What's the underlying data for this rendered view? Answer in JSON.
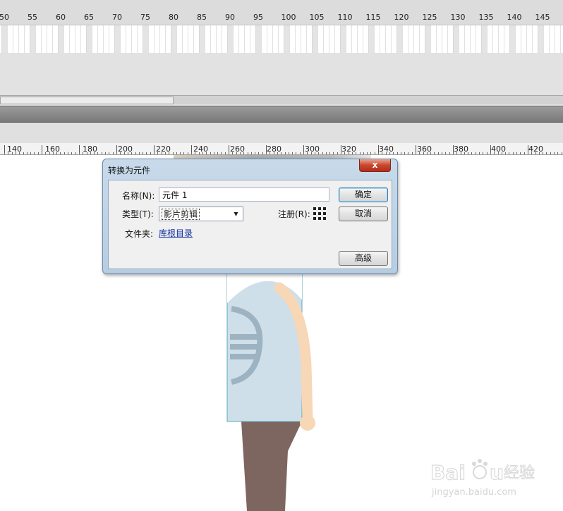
{
  "timeline": {
    "frame_numbers": [
      "50",
      "55",
      "60",
      "65",
      "70",
      "75",
      "80",
      "85",
      "90",
      "95",
      "100",
      "105",
      "110",
      "115",
      "120",
      "125",
      "130",
      "135",
      "140",
      "145"
    ]
  },
  "stage_ruler": {
    "labels": [
      "140",
      "160",
      "180",
      "200",
      "220",
      "240",
      "260",
      "280",
      "300",
      "320",
      "340",
      "360",
      "380",
      "400",
      "420"
    ]
  },
  "dialog": {
    "title": "转换为元件",
    "close_label": "x",
    "name_label": "名称(N):",
    "name_value": "元件 1",
    "type_label": "类型(T):",
    "type_value": "影片剪辑",
    "registration_label": "注册(R):",
    "folder_label": "文件夹:",
    "folder_link": "库根目录",
    "ok_label": "确定",
    "cancel_label": "取消",
    "advanced_label": "高级"
  },
  "colors": {
    "shirt": "#cfdfea",
    "shirt_stripe": "#9db3c1",
    "skin": "#f7d7b5",
    "pants": "#7e6660",
    "dialog_frame": "#b9cfe3"
  },
  "watermark": {
    "brand": "Baidu 经验",
    "url": "jingyan.baidu.com"
  }
}
